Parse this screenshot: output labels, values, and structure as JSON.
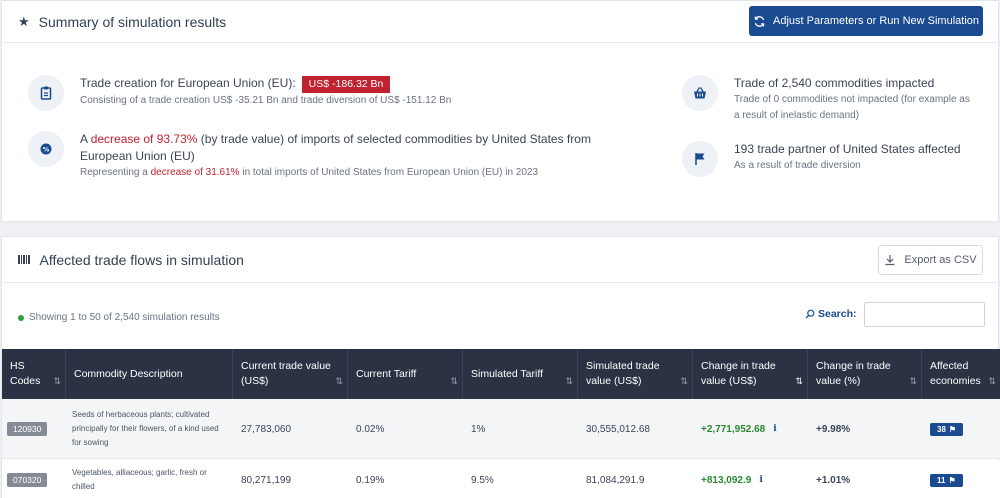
{
  "summary": {
    "title": "Summary of simulation results",
    "adjust_button": "Adjust Parameters or Run New Simulation",
    "creation": {
      "title": "Trade creation for European Union (EU):",
      "badge": "US$ -186.32 Bn",
      "sub": "Consisting of a trade creation US$ -35.21 Bn and trade diversion of US$ -151.12 Bn"
    },
    "decrease": {
      "pre": "A ",
      "highlight": "decrease of 93.73%",
      "post": " (by trade value) of imports of selected commodities by United States from European Union (EU)",
      "sub_pre": "Representing a ",
      "sub_highlight": "decrease of 31.61%",
      "sub_post": " in total imports of United States from European Union (EU) in 2023"
    },
    "commodities": {
      "title": "Trade of 2,540 commodities impacted",
      "sub": "Trade of 0 commodities not impacted (for example as a result of inelastic demand)"
    },
    "partners": {
      "title": "193 trade partner of United States affected",
      "sub": "As a result of trade diversion"
    }
  },
  "flows": {
    "title": "Affected trade flows in simulation",
    "export_button": "Export as CSV",
    "showing": "Showing 1 to 50 of 2,540 simulation results",
    "search_label": "Search:",
    "search_value": "",
    "columns": [
      "HS Codes",
      "Commodity Description",
      "Current trade value (US$)",
      "Current Tariff",
      "Simulated Tariff",
      "Simulated trade value (US$)",
      "Change in trade value (US$)",
      "Change in trade value (%)",
      "Affected economies"
    ],
    "rows": [
      {
        "hs": "120930",
        "desc": "Seeds of herbaceous plants; cultivated principally for their flowers, of a kind used for sowing",
        "current_value": "27,783,060",
        "current_tariff": "0.02%",
        "sim_tariff": "1%",
        "sim_value": "30,555,012.68",
        "change_value": "+2,771,952.68",
        "change_pct": "+9.98%",
        "economies": "38"
      },
      {
        "hs": "070320",
        "desc": "Vegetables, alliaceous; garlic, fresh or chilled",
        "current_value": "80,271,199",
        "current_tariff": "0.19%",
        "sim_tariff": "9.5%",
        "sim_value": "81,084,291.9",
        "change_value": "+813,092.9",
        "change_pct": "+1.01%",
        "economies": "11"
      }
    ]
  },
  "colors": {
    "primary": "#1a4a8f",
    "negative": "#c0222f",
    "positive": "#2a8a2f",
    "table_header": "#2a3244"
  }
}
